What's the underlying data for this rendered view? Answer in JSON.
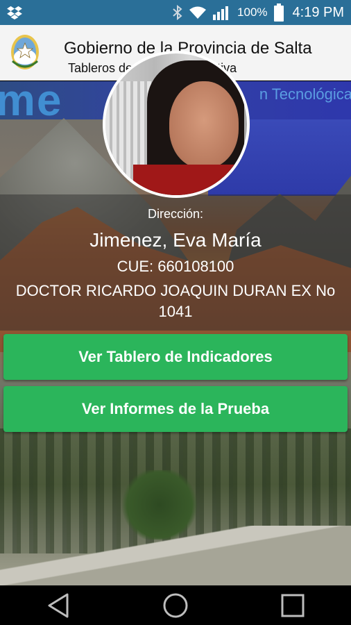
{
  "status_bar": {
    "battery_percent": "100%",
    "time": "4:19 PM",
    "icons": [
      "dropbox-icon",
      "bluetooth-icon",
      "wifi-icon",
      "signal-icon",
      "battery-icon"
    ]
  },
  "header": {
    "title": "Gobierno de la Provincia de Salta",
    "subtitle": "Tableros de … lidad Educativa",
    "logo_icon": "provincial-seal-icon"
  },
  "banner": {
    "partial_text_left": "me",
    "partial_text_right": "n Tecnológica"
  },
  "profile": {
    "direccion_label": "Dirección:",
    "name": "Jimenez, Eva María",
    "cue": "CUE: 660108100",
    "address": "DOCTOR RICARDO JOAQUIN DURAN EX No 1041"
  },
  "buttons": {
    "tablero": "Ver Tablero de Indicadores",
    "informes": "Ver Informes de la Prueba"
  },
  "colors": {
    "status_bar": "#2a6f98",
    "button_green": "#2bb55b",
    "header_bg": "#f4f4f4"
  },
  "navigation": {
    "items": [
      "back-icon",
      "home-icon",
      "recents-icon"
    ]
  }
}
